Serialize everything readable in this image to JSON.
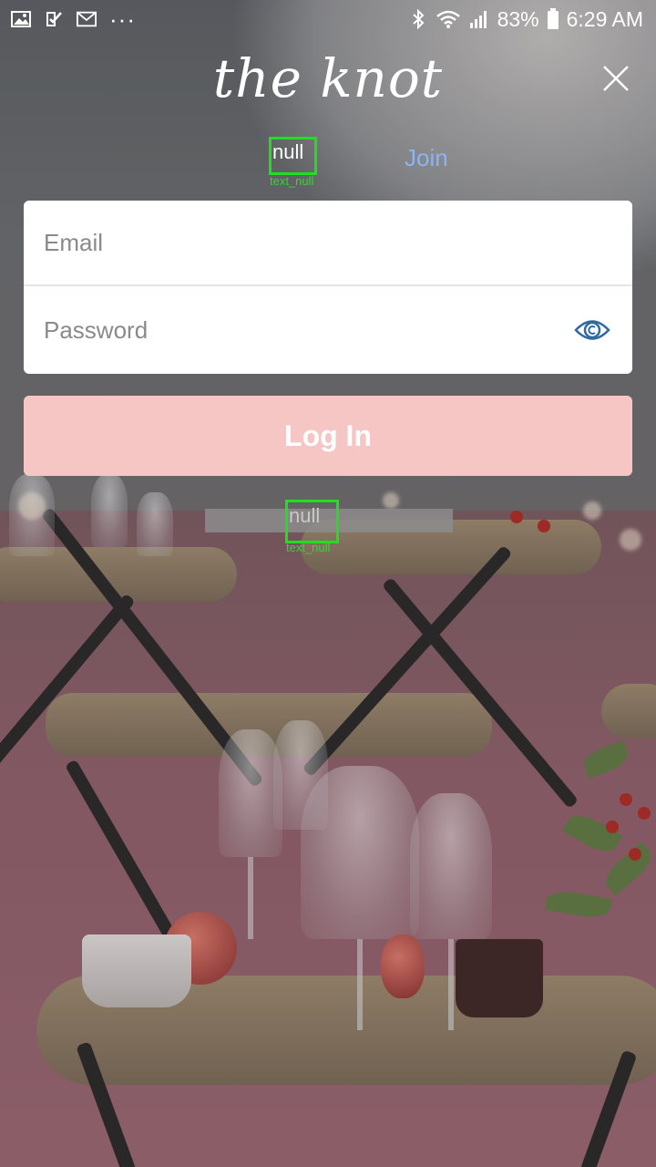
{
  "status_bar": {
    "battery": "83%",
    "time": "6:29 AM",
    "dots": "···",
    "icons": [
      "gallery-icon",
      "check-icon",
      "gmail-icon",
      "more-icon",
      "bluetooth-icon",
      "wifi-icon",
      "signal-icon",
      "battery-icon"
    ]
  },
  "header": {
    "logo": "the knot",
    "close_icon": "close-icon"
  },
  "tabs": {
    "login_label": "null",
    "login_caption": "text_null",
    "join_label": "Join"
  },
  "form": {
    "email_placeholder": "Email",
    "password_placeholder": "Password",
    "eye_icon": "eye-icon"
  },
  "login_button": {
    "label": "Log In"
  },
  "forgot": {
    "label": "null",
    "caption": "text_null"
  },
  "colors": {
    "join": "#8ab4f8",
    "login_button": "#f5c6c3",
    "eye_icon": "#2f6aa1",
    "highlight_box": "#1ee01e"
  }
}
